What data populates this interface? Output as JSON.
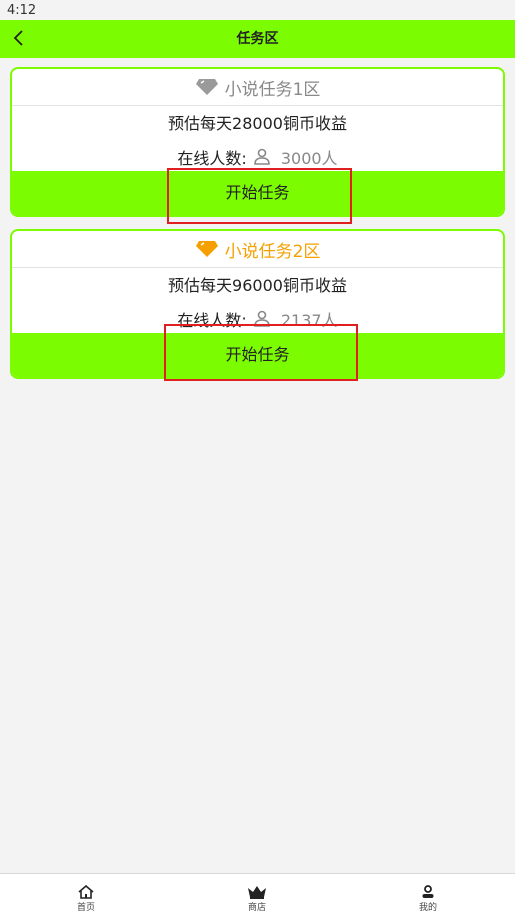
{
  "status_bar": {
    "time": "4:12"
  },
  "header": {
    "title": "任务区"
  },
  "tasks": [
    {
      "title": "小说任务1区",
      "title_color": "#888888",
      "gem_color": "#9a9a9a",
      "estimate": "预估每天28000铜币收益",
      "online_label": "在线人数:",
      "online_count": "3000人",
      "button": "开始任务"
    },
    {
      "title": "小说任务2区",
      "title_color": "#f5a000",
      "gem_color": "#f5a000",
      "estimate": "预估每天96000铜币收益",
      "online_label": "在线人数:",
      "online_count": "2137人",
      "button": "开始任务"
    }
  ],
  "tabs": [
    {
      "label": "首页",
      "icon": "home-icon"
    },
    {
      "label": "商店",
      "icon": "crown-icon"
    },
    {
      "label": "我的",
      "icon": "person-icon"
    }
  ],
  "colors": {
    "accent": "#7cfc00",
    "highlight": "#e02020"
  }
}
